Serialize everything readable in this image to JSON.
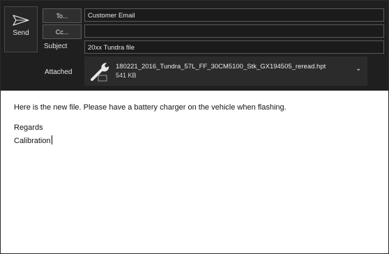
{
  "compose": {
    "send_label": "Send",
    "to_button": "To...",
    "cc_button": "Cc...",
    "subject_label": "Subject",
    "attached_label": "Attached",
    "to_value": "Customer Email",
    "cc_value": "",
    "subject_value": "20xx Tundra file"
  },
  "attachment": {
    "filename": "180221_2016_Tundra_57L_FF_30CM5100_Stk_GX194505_reread.hpt",
    "size": "541 KB",
    "icon": "wrench-icon",
    "menu_icon": "chevron-down-icon"
  },
  "body": {
    "lines": [
      "Here is the new file.  Please have a battery charger on the vehicle when flashing.",
      "Regards",
      "Calibration"
    ]
  },
  "colors": {
    "header_bg": "#1f1f1f",
    "input_bg": "#1b1b1b",
    "attachment_bg": "#2b2b2b",
    "text_light": "#e6e6e6"
  }
}
